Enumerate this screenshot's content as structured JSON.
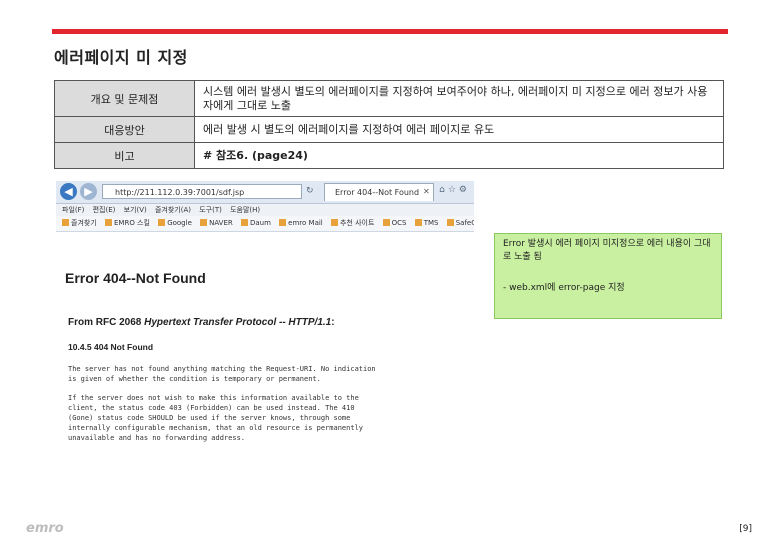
{
  "title": "에러페이지 미 지정",
  "table": {
    "rows": [
      {
        "header": "개요 및 문제점",
        "content": "시스템 에러 발생시 별도의 에러페이지를 지정하여 보여주어야 하나, 에러페이지 미 지정으로 에러 정보가 사용자에게 그대로 노출"
      },
      {
        "header": "대응방안",
        "content": "에러 발생 시 별도의 에러페이지를 지정하여 에러 페이지로 유도"
      },
      {
        "header": "비고",
        "content": "# 참조6. (page24)"
      }
    ]
  },
  "browser": {
    "address": "http://211.112.0.39:7001/sdf.jsp",
    "tab_title": "Error 404--Not Found",
    "menu": [
      "파일(F)",
      "편집(E)",
      "보기(V)",
      "즐겨찾기(A)",
      "도구(T)",
      "도움말(H)"
    ],
    "favorites": [
      "즐겨찾기",
      "EMRO 스킬",
      "Google",
      "NAVER",
      "Daum",
      "emro Mail",
      "추천 사이트",
      "OCS",
      "TMS",
      "SafeGuard"
    ]
  },
  "error_page": {
    "heading": "Error 404--Not Found",
    "rfc_prefix": "From RFC 2068 ",
    "rfc_italic": "Hypertext Transfer Protocol -- HTTP/1.1",
    "rfc_suffix": ":",
    "code_heading": "10.4.5 404 Not Found",
    "para1": "The server has not found anything matching the Request-URI. No indication\nis given of whether the condition is temporary or permanent.",
    "para2": "If the server does not wish to make this information available to the\nclient, the status code 403 (Forbidden) can be used instead. The 410\n(Gone) status code SHOULD be used if the server knows, through some\ninternally configurable mechanism, that an old resource is permanently\nunavailable and has no forwarding address."
  },
  "note": {
    "line1": "Error 발생시 에러 페이지 미지정으로 에러 내용이 그대로 노출 됨",
    "line2": "- web.xml에 error-page 지정"
  },
  "footer": {
    "logo": "emro",
    "page": "[9]"
  }
}
